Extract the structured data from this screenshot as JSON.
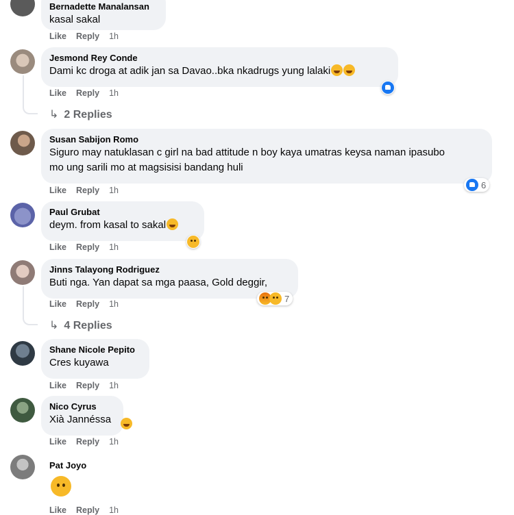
{
  "actions": {
    "like": "Like",
    "reply": "Reply"
  },
  "comments": [
    {
      "author": "Bernadette Manalansan",
      "text": "kasal sakal",
      "time": "1h"
    },
    {
      "author": "Jesmond Rey Conde",
      "text": "Dami kc droga at adik jan sa Davao..bka nkadrugs yung lalaki",
      "time": "1h",
      "replies": "2 Replies"
    },
    {
      "author": "Susan Sabijon Romo",
      "text": "Siguro may natuklasan c girl na bad attitude n boy kaya umatras keysa naman ipasubo mo ung sarili mo at magsisisi bandang huli",
      "time": "1h",
      "reaction_count": "6"
    },
    {
      "author": "Paul Grubat",
      "text": "deym. from kasal to sakal",
      "time": "1h"
    },
    {
      "author": "Jinns Talayong Rodriguez",
      "text": "Buti nga. Yan dapat sa mga paasa, Gold deggir,",
      "time": "1h",
      "reaction_count": "7",
      "replies": "4 Replies"
    },
    {
      "author": "Shane Nicole Pepito",
      "text": "Cres kuyawa",
      "time": "1h"
    },
    {
      "author": "Nico Cyrus",
      "text": "Xià Jannéssa",
      "time": "1h"
    },
    {
      "author": "Pat Joyo",
      "text": "",
      "time": "1h"
    }
  ]
}
